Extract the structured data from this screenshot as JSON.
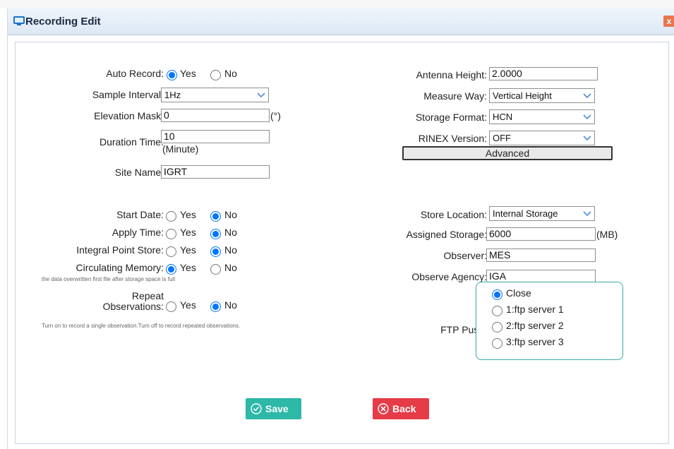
{
  "dialog": {
    "title": "Recording Edit",
    "close_label": "x"
  },
  "left": {
    "auto_record": {
      "label": "Auto Record:",
      "yes": "Yes",
      "no": "No",
      "selected": "Yes"
    },
    "sample_interval": {
      "label": "Sample Interval:",
      "value": "1Hz"
    },
    "elevation_mask": {
      "label": "Elevation Mask:",
      "value": "0",
      "unit": "(°)"
    },
    "duration_time": {
      "label": "Duration Time:",
      "value": "10",
      "unit": "(Minute)"
    },
    "site_name": {
      "label": "Site Name:",
      "value": "IGRT"
    },
    "start_date": {
      "label": "Start Date:",
      "yes": "Yes",
      "no": "No",
      "selected": "No"
    },
    "apply_time": {
      "label": "Apply Time:",
      "yes": "Yes",
      "no": "No",
      "selected": "No"
    },
    "integral_point_store": {
      "label": "Integral Point Store:",
      "yes": "Yes",
      "no": "No",
      "selected": "No"
    },
    "circulating_memory": {
      "label": "Circulating Memory:",
      "yes": "Yes",
      "no": "No",
      "selected": "Yes",
      "note": "the data overwritten first file after storage space is full"
    },
    "repeat_observations": {
      "label_line1": "Repeat",
      "label_line2": "Observations:",
      "yes": "Yes",
      "no": "No",
      "selected": "No",
      "note": "Turn on to record a single observation.Turn off to record repeated observations."
    }
  },
  "right": {
    "antenna_height": {
      "label": "Antenna Height:",
      "value": "2.0000"
    },
    "measure_way": {
      "label": "Measure Way:",
      "value": "Vertical Height"
    },
    "storage_format": {
      "label": "Storage Format:",
      "value": "HCN"
    },
    "rinex_version": {
      "label": "RINEX Version:",
      "value": "OFF"
    },
    "advanced_label": "Advanced",
    "store_location": {
      "label": "Store Location:",
      "value": "Internal Storage"
    },
    "assigned_storage": {
      "label": "Assigned Storage:",
      "value": "6000",
      "unit": "(MB)"
    },
    "observer": {
      "label": "Observer:",
      "value": "MES"
    },
    "observe_agency": {
      "label": "Observe Agency:",
      "value": "IGA"
    },
    "ftp_push": {
      "label": "FTP Push:",
      "options": [
        "Close",
        "1:ftp server 1",
        "2:ftp server 2",
        "3:ftp server 3"
      ],
      "selected": "Close"
    }
  },
  "buttons": {
    "save": "Save",
    "back": "Back"
  },
  "colors": {
    "save": "#2eb8a8",
    "back": "#e53c48",
    "radio_on": "#0075ff",
    "ftp_border": "#3aa7a7"
  }
}
